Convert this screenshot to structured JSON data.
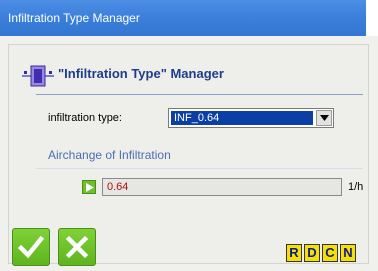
{
  "window": {
    "title": "Infiltration Type Manager"
  },
  "header": {
    "title": "\"Infiltration Type\" Manager"
  },
  "form": {
    "type_label": "infiltration type:",
    "type_value": "INF_0.64"
  },
  "airchange": {
    "section_title": "Airchange of Infiltration",
    "value": "0.64",
    "unit": "1/h"
  },
  "buttons": {
    "r": "R",
    "d": "D",
    "c": "C",
    "n": "N"
  },
  "colors": {
    "titlebar": "#3a7edb",
    "accent_green": "#5fb41f",
    "selected_blue": "#0a3fa6",
    "value_text": "#b01010",
    "letter_button_bg": "#f7e000",
    "letter_button_text": "#0a1a9a"
  },
  "icons": {
    "header": "manager-window-icon",
    "expand": "play-arrow-icon",
    "ok": "checkmark-icon",
    "cancel": "x-icon",
    "dropdown": "chevron-down-icon"
  }
}
